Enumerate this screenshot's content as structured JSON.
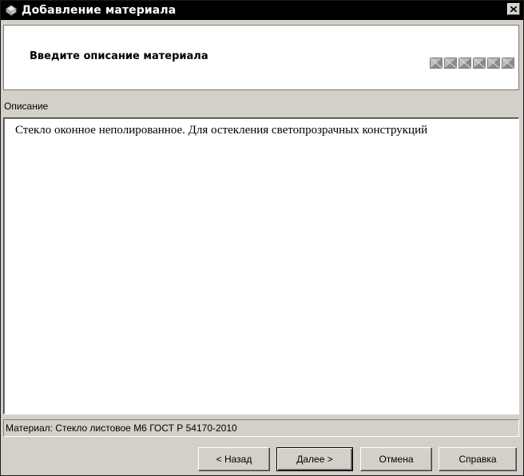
{
  "window": {
    "title": "Добавление материала",
    "app_icon": "material-icon",
    "close_icon": "close-icon"
  },
  "header": {
    "prompt": "Введите описание материала",
    "step_icons": [
      "step-icon",
      "step-icon",
      "step-icon",
      "step-icon",
      "step-icon",
      "step-icon"
    ]
  },
  "description": {
    "label": "Описание",
    "value": "Стекло оконное неполированное. Для остекления светопрозрачных конструкций"
  },
  "status": {
    "text": "Материал: Стекло листовое М6 ГОСТ Р 54170-2010"
  },
  "buttons": {
    "back": "< Назад",
    "next": "Далее >",
    "cancel": "Отмена",
    "help": "Справка"
  }
}
